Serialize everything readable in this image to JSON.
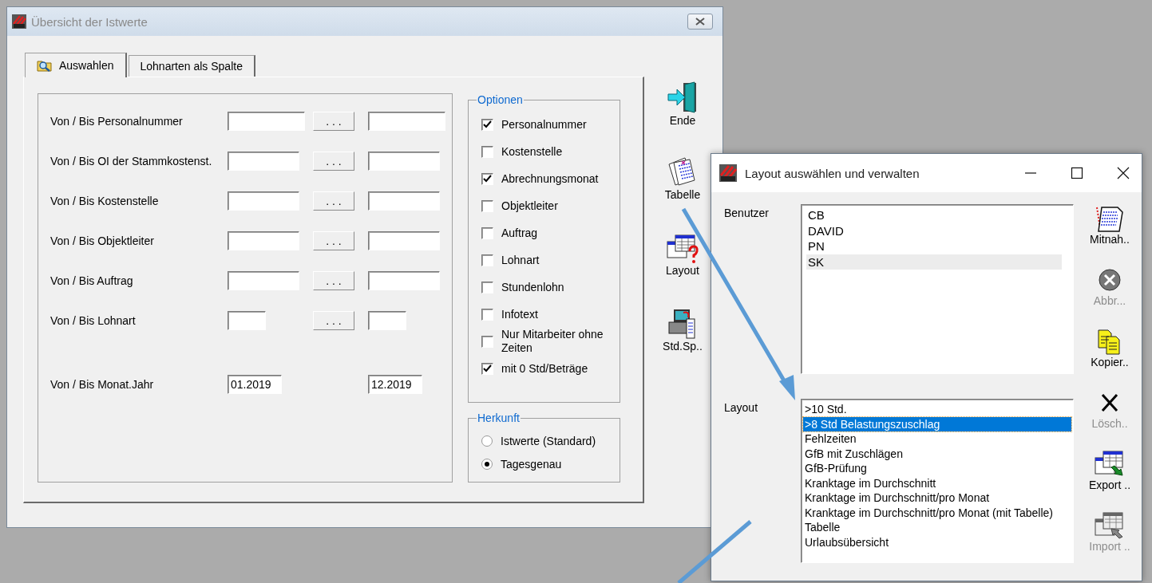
{
  "main_window": {
    "title": "Übersicht der Istwerte",
    "tabs": [
      {
        "label": "Auswahlen",
        "selected": true,
        "has_icon": true
      },
      {
        "label": "Lohnarten als Spalte",
        "selected": false,
        "has_icon": false
      }
    ],
    "ranges": [
      {
        "label": "Von / Bis Personalnummer",
        "kind": "picker_wide",
        "button": ". . ."
      },
      {
        "label": "Von / Bis OI der Stammkostenst.",
        "kind": "picker",
        "button": ". . ."
      },
      {
        "label": "Von / Bis Kostenstelle",
        "kind": "picker",
        "button": ". . ."
      },
      {
        "label": "Von / Bis Objektleiter",
        "kind": "picker",
        "button": ". . ."
      },
      {
        "label": "Von / Bis Auftrag",
        "kind": "picker",
        "button": ". . ."
      },
      {
        "label": "Von / Bis Lohnart",
        "kind": "picker_short",
        "button": ". . ."
      },
      {
        "label": "Von / Bis Monat.Jahr",
        "kind": "period",
        "from": "01.2019",
        "to": "12.2019"
      }
    ],
    "options": {
      "title": "Optionen",
      "items": [
        {
          "label": "Personalnummer",
          "checked": true
        },
        {
          "label": "Kostenstelle",
          "checked": false
        },
        {
          "label": "Abrechnungsmonat",
          "checked": true
        },
        {
          "label": "Objektleiter",
          "checked": false
        },
        {
          "label": "Auftrag",
          "checked": false
        },
        {
          "label": "Lohnart",
          "checked": false
        },
        {
          "label": "Stundenlohn",
          "checked": false
        },
        {
          "label": "Infotext",
          "checked": false
        },
        {
          "label": "Nur Mitarbeiter ohne Zeiten",
          "checked": false
        },
        {
          "label": "mit 0 Std/Beträge",
          "checked": true
        }
      ]
    },
    "origin": {
      "title": "Herkunft",
      "items": [
        {
          "label": "Istwerte (Standard)",
          "selected": false
        },
        {
          "label": "Tagesgenau",
          "selected": true
        }
      ]
    },
    "toolbar": [
      {
        "label": "Ende",
        "kind": "exit"
      },
      {
        "label": "Tabelle",
        "kind": "table"
      },
      {
        "label": "Layout",
        "kind": "layout"
      },
      {
        "label": "Std.Sp..",
        "kind": "hours"
      }
    ]
  },
  "layout_dialog": {
    "title": "Layout auswählen und verwalten",
    "users_label": "Benutzer",
    "users_focused": false,
    "users": [
      {
        "name": "CB",
        "selected": false
      },
      {
        "name": "DAVID",
        "selected": false
      },
      {
        "name": "PN",
        "selected": false
      },
      {
        "name": "SK",
        "selected": true
      }
    ],
    "layouts_label": "Layout",
    "layouts_focused": true,
    "layouts": [
      {
        "name": ">10 Std.",
        "selected": false
      },
      {
        "name": ">8 Std Belastungszuschlag",
        "selected": true
      },
      {
        "name": "Fehlzeiten",
        "selected": false
      },
      {
        "name": "GfB mit Zuschlägen",
        "selected": false
      },
      {
        "name": "GfB-Prüfung",
        "selected": false
      },
      {
        "name": "Kranktage im Durchschnitt",
        "selected": false
      },
      {
        "name": "Kranktage im Durchschnitt/pro Monat",
        "selected": false
      },
      {
        "name": "Kranktage im Durchschnitt/pro Monat (mit Tabelle)",
        "selected": false
      },
      {
        "name": "Tabelle",
        "selected": false
      },
      {
        "name": "Urlaubsübersicht",
        "selected": false
      }
    ],
    "toolbar": [
      {
        "label": "Mitnah..",
        "kind": "take",
        "disabled": false
      },
      {
        "label": "Abbr...",
        "kind": "cancel",
        "disabled": true
      },
      {
        "label": "Kopier..",
        "kind": "copy",
        "disabled": false
      },
      {
        "label": "Lösch..",
        "kind": "delete",
        "disabled": true
      },
      {
        "label": "Export ..",
        "kind": "export",
        "disabled": false
      },
      {
        "label": "Import ..",
        "kind": "import",
        "disabled": true
      }
    ]
  }
}
